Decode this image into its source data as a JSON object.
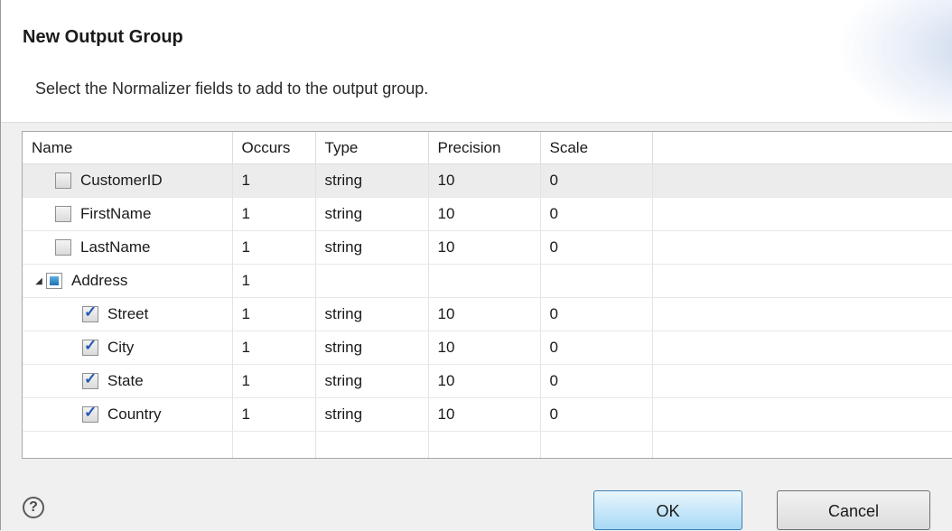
{
  "dialog": {
    "title": "New Output Group",
    "subtitle": "Select the Normalizer fields to add to the output group."
  },
  "table": {
    "columns": [
      "Name",
      "Occurs",
      "Type",
      "Precision",
      "Scale"
    ],
    "rows": [
      {
        "name": "CustomerID",
        "occurs": "1",
        "type": "string",
        "precision": "10",
        "scale": "0",
        "checked": false,
        "level": 0
      },
      {
        "name": "FirstName",
        "occurs": "1",
        "type": "string",
        "precision": "10",
        "scale": "0",
        "checked": false,
        "level": 0
      },
      {
        "name": "LastName",
        "occurs": "1",
        "type": "string",
        "precision": "10",
        "scale": "0",
        "checked": false,
        "level": 0
      },
      {
        "name": "Address",
        "occurs": "1",
        "type": "",
        "precision": "",
        "scale": "",
        "checked": "partial",
        "level": 0,
        "expanded": true
      },
      {
        "name": "Street",
        "occurs": "1",
        "type": "string",
        "precision": "10",
        "scale": "0",
        "checked": true,
        "level": 1
      },
      {
        "name": "City",
        "occurs": "1",
        "type": "string",
        "precision": "10",
        "scale": "0",
        "checked": true,
        "level": 1
      },
      {
        "name": "State",
        "occurs": "1",
        "type": "string",
        "precision": "10",
        "scale": "0",
        "checked": true,
        "level": 1
      },
      {
        "name": "Country",
        "occurs": "1",
        "type": "string",
        "precision": "10",
        "scale": "0",
        "checked": true,
        "level": 1
      }
    ]
  },
  "buttons": {
    "ok": "OK",
    "cancel": "Cancel",
    "help": "?"
  },
  "colors": {
    "ok_border": "#3c7fb1",
    "check_mark": "#2458b5"
  }
}
